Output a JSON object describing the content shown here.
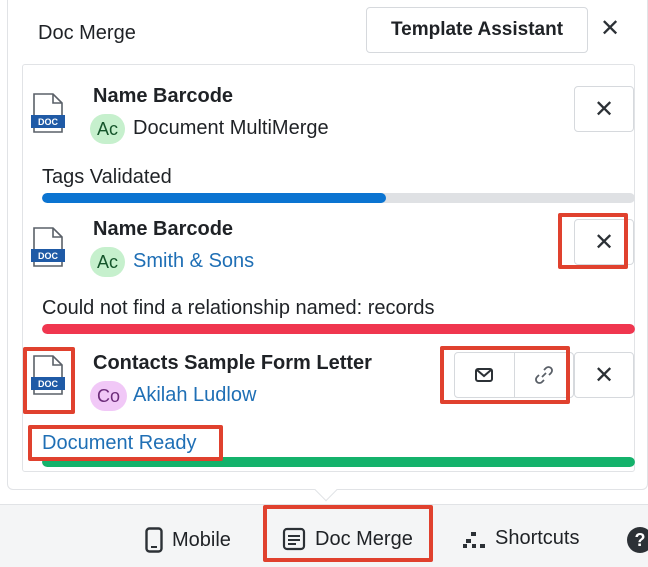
{
  "header": {
    "title": "Doc Merge",
    "template_assistant_label": "Template Assistant",
    "close_label": "✕"
  },
  "items": [
    {
      "title": "Name Barcode",
      "avatar": "Ac",
      "record": "Document MultiMerge",
      "status": "Tags Validated",
      "progress": 0.58,
      "progress_color": "#0b74d1",
      "remove_label": "✕"
    },
    {
      "title": "Name Barcode",
      "avatar": "Ac",
      "record": "Smith & Sons",
      "status": "Could not find a relationship named: records",
      "progress": 1.0,
      "progress_color": "#f0364f",
      "remove_label": "✕"
    },
    {
      "title": "Contacts Sample Form Letter",
      "avatar": "Co",
      "record": "Akilah Ludlow",
      "status": "Document Ready",
      "progress": 1.0,
      "progress_color": "#14b26b",
      "remove_label": "✕"
    }
  ],
  "doc_icon_label": "DOC",
  "footer": {
    "mobile_label": "Mobile",
    "docmerge_label": "Doc Merge",
    "shortcuts_label": "Shortcuts",
    "help_label": "?"
  },
  "colors": {
    "highlight": "#e0412e",
    "link": "#1f6fb5"
  },
  "icons": [
    "doc-file-icon",
    "email-icon",
    "link-icon",
    "mobile-icon",
    "doc-merge-icon",
    "shortcuts-icon",
    "help-icon"
  ]
}
